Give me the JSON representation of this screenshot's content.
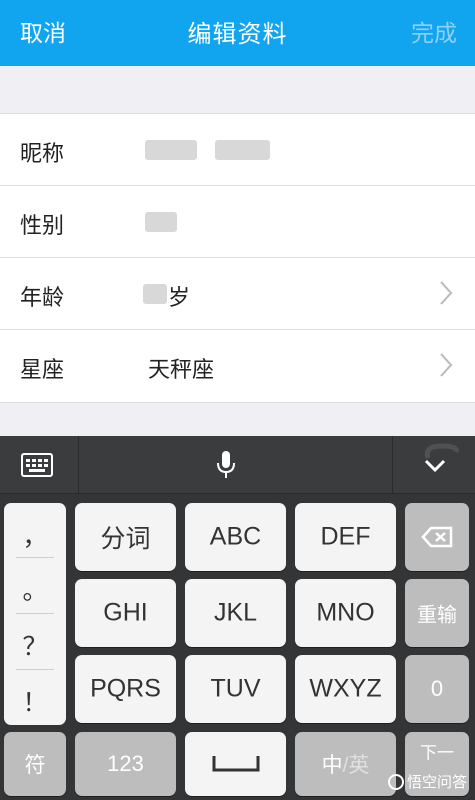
{
  "header": {
    "cancel": "取消",
    "title": "编辑资料",
    "done": "完成"
  },
  "form": {
    "rows": [
      {
        "label": "昵称",
        "value": ""
      },
      {
        "label": "性别",
        "value": ""
      },
      {
        "label": "年龄",
        "value": "岁"
      },
      {
        "label": "星座",
        "value": "天秤座"
      }
    ]
  },
  "toolbar": {
    "icons": [
      "keyboard-icon",
      "microphone-icon",
      "chevron-down-icon",
      "sogou-logo-icon"
    ]
  },
  "keyboard": {
    "punctuation": [
      "，",
      "。",
      "？",
      "！"
    ],
    "row1": [
      "分词",
      "ABC",
      "DEF"
    ],
    "row2": [
      "GHI",
      "JKL",
      "MNO"
    ],
    "row3": [
      "PQRS",
      "TUV",
      "WXYZ"
    ],
    "right": {
      "delete": "",
      "retype": "重输",
      "zero": "0",
      "next": "下一"
    },
    "bottom": {
      "symbols": "符",
      "numbers": "123",
      "space": "",
      "lang_cn": "中",
      "lang_sep": "/",
      "lang_en": "英"
    }
  },
  "watermark": {
    "text": "悟空问答"
  },
  "colors": {
    "header": "#12a5ef",
    "keyboard_bg": "#333537",
    "key": "#f4f4f4",
    "key_dark": "#bdbdbd"
  }
}
